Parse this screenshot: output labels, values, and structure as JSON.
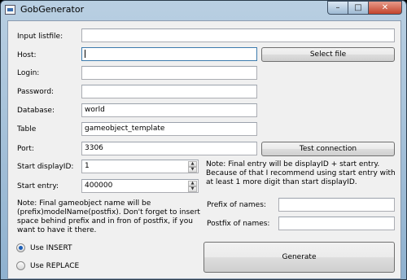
{
  "window": {
    "title": "GobGenerator"
  },
  "form": {
    "input_listfile": {
      "label": "Input listfile:",
      "value": ""
    },
    "host": {
      "label": "Host:",
      "value": ""
    },
    "login": {
      "label": "Login:",
      "value": ""
    },
    "password": {
      "label": "Password:",
      "value": ""
    },
    "database": {
      "label": "Database:",
      "value": "world"
    },
    "table": {
      "label": "Table",
      "value": "gameobject_template"
    },
    "port": {
      "label": "Port:",
      "value": "3306"
    },
    "start_display_id": {
      "label": "Start displayID:",
      "value": "1"
    },
    "start_entry": {
      "label": "Start entry:",
      "value": "400000"
    },
    "prefix": {
      "label": "Prefix of names:",
      "value": ""
    },
    "postfix": {
      "label": "Postfix of names:",
      "value": ""
    }
  },
  "buttons": {
    "select_file": "Select file",
    "test_connection": "Test connection",
    "generate": "Generate"
  },
  "notes": {
    "entry_note": "Note: Final entry will be displayID + start entry. Because of that I recommend using start entry with at least 1 more digit than start displayID.",
    "name_note": "Note: Final gameobject name will be (prefix)modelName(postfix). Don't forget to insert space behind prefix and in fron of postfix, if you want to have it there."
  },
  "options": {
    "use_insert": {
      "label": "Use INSERT",
      "selected": true
    },
    "use_replace": {
      "label": "Use REPLACE",
      "selected": false
    }
  }
}
